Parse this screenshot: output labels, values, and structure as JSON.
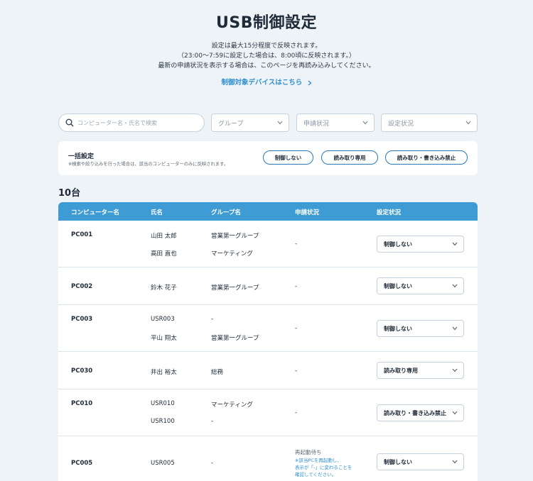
{
  "header": {
    "title": "USB制御設定",
    "desc_line1": "設定は最大15分程度で反映されます。",
    "desc_line2": "（23:00〜7:59に設定した場合は、8:00頃に反映されます。）",
    "desc_line3": "最新の申請状況を表示する場合は、このページを再読み込みしてください。",
    "device_link": "制御対象デバイスはこちら"
  },
  "filters": {
    "search_placeholder": "コンピューター名・氏名で検索",
    "group": "グループ",
    "application_status": "申請状況",
    "setting_status": "設定状況"
  },
  "bulk": {
    "title": "一括設定",
    "note": "※検索や絞り込みを行った場合は、該当のコンピューターのみに反映されます。",
    "btn_no_control": "制御しない",
    "btn_read_only": "読み取り専用",
    "btn_block_all": "読み取り・書き込み禁止"
  },
  "count": "10台",
  "table": {
    "headers": [
      "コンピューター名",
      "氏名",
      "グループ名",
      "申請状況",
      "設定状況"
    ],
    "rows": [
      {
        "pc": "PC001",
        "users": [
          "山田 太郎",
          "高田 直也"
        ],
        "groups": [
          "営業第一グループ",
          "マーケティング"
        ],
        "status": "-",
        "setting": "制御しない"
      },
      {
        "pc": "PC002",
        "users": [
          "鈴木 花子"
        ],
        "groups": [
          "営業第一グループ"
        ],
        "status": "-",
        "setting": "制御しない"
      },
      {
        "pc": "PC003",
        "users": [
          "USR003",
          "平山 翔太"
        ],
        "groups": [
          "-",
          "営業第一グループ"
        ],
        "status": "-",
        "setting": "制御しない"
      },
      {
        "pc": "PC030",
        "users": [
          "井出 裕太"
        ],
        "groups": [
          "総務"
        ],
        "status": "-",
        "setting": "読み取り専用"
      },
      {
        "pc": "PC010",
        "users": [
          "USR010",
          "USR100"
        ],
        "groups": [
          "マーケティング",
          "-"
        ],
        "status": "-",
        "setting": "読み取り・書き込み禁止"
      },
      {
        "pc": "PC005",
        "users": [
          "USR005"
        ],
        "groups": [
          "-"
        ],
        "status_title": "再起動待ち",
        "status_note": [
          "※該当PCを再起動し、",
          "表示が「-」に変わることを",
          "確認してください。"
        ],
        "setting": "制御しない"
      }
    ]
  },
  "colors": {
    "accent": "#3f9bd4",
    "link": "#2f8fcf",
    "background": "#eef3f7"
  }
}
